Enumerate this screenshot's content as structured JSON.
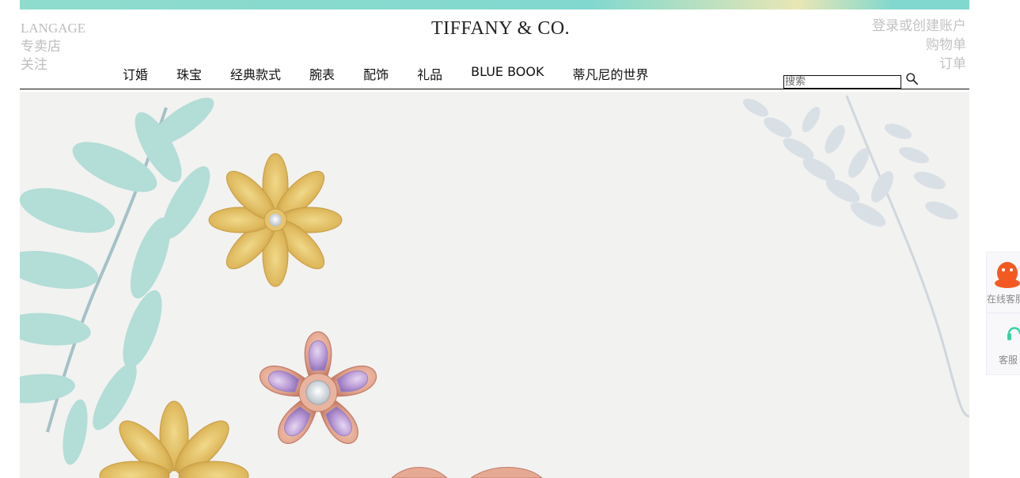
{
  "header": {
    "left_links": [
      "LANGAGE",
      "专卖店",
      "关注"
    ],
    "logo_text": "TIFFANY & CO.",
    "right_links": [
      "登录或创建账户",
      "购物单",
      "订单"
    ]
  },
  "nav": {
    "items": [
      "订婚",
      "珠宝",
      "经典款式",
      "腕表",
      "配饰",
      "礼品",
      "BLUE BOOK",
      "蒂凡尼的世界"
    ]
  },
  "search": {
    "placeholder": "搜索",
    "icon": "magnifier-icon"
  },
  "hero": {
    "subject": "jewelry-flower-brooches",
    "icons": [
      "leaf-illustration",
      "gold-flower",
      "rose-gold-amethyst-flower"
    ]
  },
  "service_panel": {
    "items": [
      {
        "label": "在线客服",
        "icon": "qq-penguin-icon"
      },
      {
        "label": "客服",
        "icon": "headset-icon"
      }
    ]
  },
  "colors": {
    "tiffany_blue": "#81d8cf",
    "link_gray": "#bdbdbd",
    "text_dark": "#111111",
    "qq_orange": "#f25a22",
    "headset_green": "#38d39f"
  }
}
